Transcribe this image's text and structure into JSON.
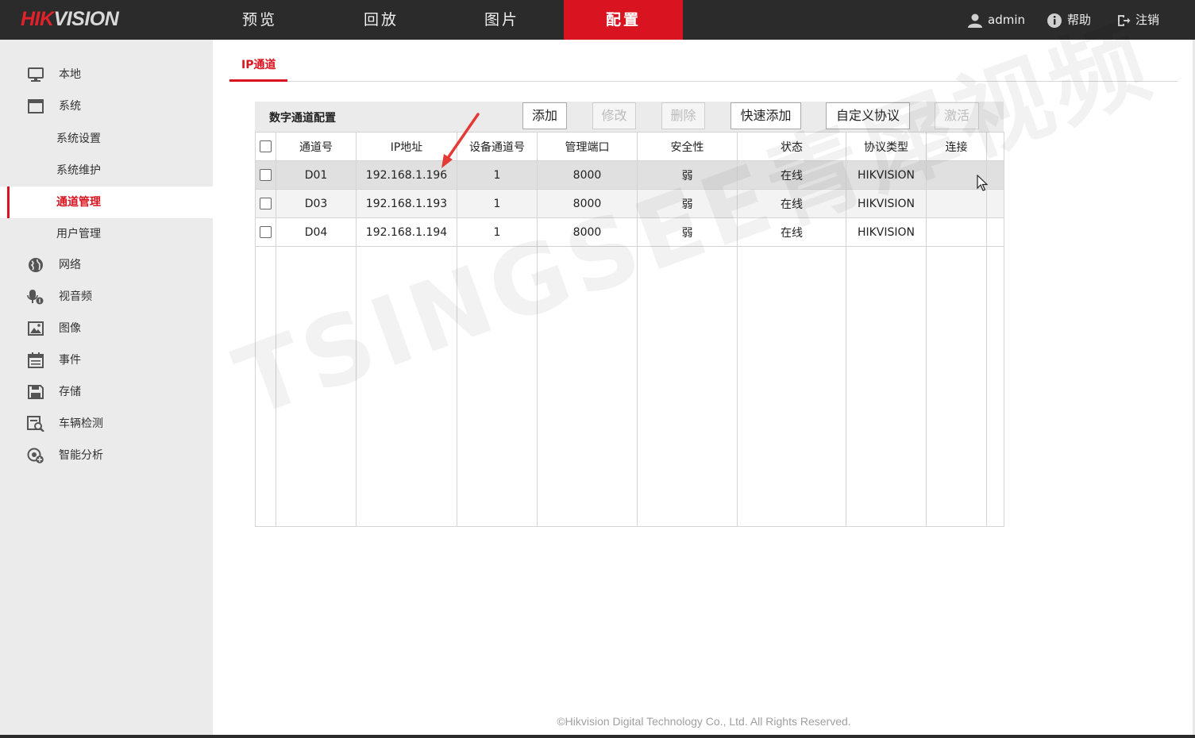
{
  "brand": {
    "logo_part1": "HIK",
    "logo_part2": "VISION"
  },
  "topnav": {
    "items": [
      {
        "label": "预览"
      },
      {
        "label": "回放"
      },
      {
        "label": "图片"
      },
      {
        "label": "配置"
      }
    ],
    "active": "配置"
  },
  "user": {
    "username": "admin",
    "help": "帮助",
    "logout": "注销"
  },
  "sidebar": {
    "items": [
      {
        "label": "本地",
        "icon": "monitor-icon"
      },
      {
        "label": "系统",
        "icon": "system-icon"
      },
      {
        "label": "系统设置"
      },
      {
        "label": "系统维护"
      },
      {
        "label": "通道管理"
      },
      {
        "label": "用户管理"
      },
      {
        "label": "网络",
        "icon": "globe-icon"
      },
      {
        "label": "视音频",
        "icon": "video-audio-icon"
      },
      {
        "label": "图像",
        "icon": "image-icon"
      },
      {
        "label": "事件",
        "icon": "calendar-icon"
      },
      {
        "label": "存储",
        "icon": "save-icon"
      },
      {
        "label": "车辆检测",
        "icon": "vehicle-detect-icon"
      },
      {
        "label": "智能分析",
        "icon": "smart-analysis-icon"
      }
    ],
    "active": "通道管理"
  },
  "tab": {
    "label": "IP通道"
  },
  "panel": {
    "title": "数字通道配置",
    "buttons": {
      "add": "添加",
      "modify": "修改",
      "delete": "删除",
      "quick_add": "快速添加",
      "custom_protocol": "自定义协议",
      "activate": "激活"
    },
    "columns": [
      "通道号",
      "IP地址",
      "设备通道号",
      "管理端口",
      "安全性",
      "状态",
      "协议类型",
      "连接"
    ],
    "rows": [
      {
        "channel": "D01",
        "ip": "192.168.1.196",
        "dev_channel": "1",
        "port": "8000",
        "security": "弱",
        "status": "在线",
        "protocol": "HIKVISION",
        "connect": ""
      },
      {
        "channel": "D03",
        "ip": "192.168.1.193",
        "dev_channel": "1",
        "port": "8000",
        "security": "弱",
        "status": "在线",
        "protocol": "HIKVISION",
        "connect": ""
      },
      {
        "channel": "D04",
        "ip": "192.168.1.194",
        "dev_channel": "1",
        "port": "8000",
        "security": "弱",
        "status": "在线",
        "protocol": "HIKVISION",
        "connect": ""
      }
    ]
  },
  "watermark": "TSINGSEE青犀视频",
  "footer": "©Hikvision Digital Technology Co., Ltd. All Rights Reserved.",
  "colors": {
    "accent": "#d9131f",
    "topbar": "#2b2b2b",
    "sidebar": "#ebebeb"
  }
}
